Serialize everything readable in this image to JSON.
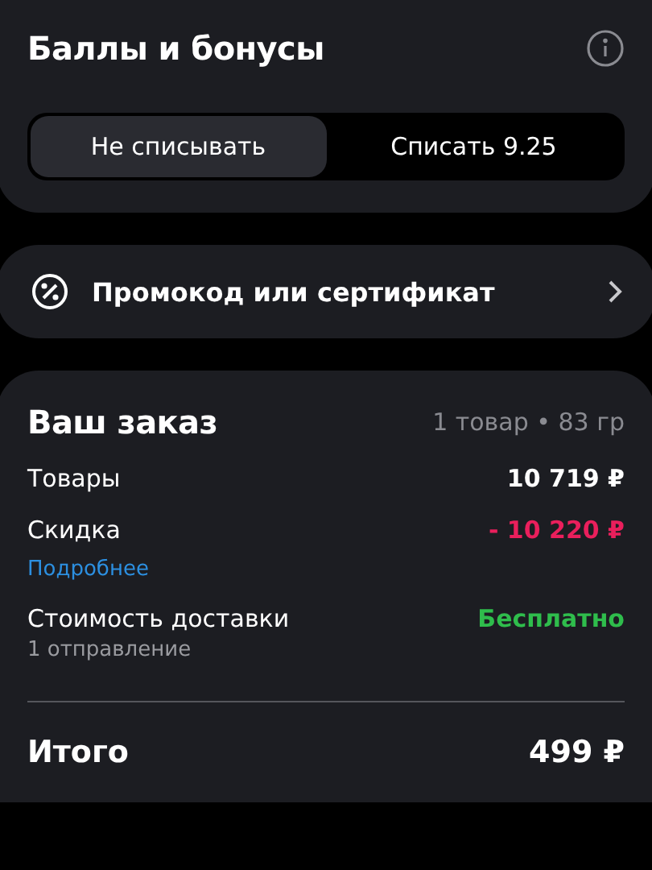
{
  "bonuses": {
    "title": "Баллы и бонусы",
    "options": [
      {
        "label": "Не списывать",
        "selected": true
      },
      {
        "label": "Списать 9.25",
        "selected": false
      }
    ]
  },
  "promo": {
    "label": "Промокод или сертификат"
  },
  "order": {
    "title": "Ваш заказ",
    "summary": "1 товар • 83 гр",
    "rows": [
      {
        "label": "Товары",
        "value": "10 719 ₽",
        "kind": "plain"
      },
      {
        "label": "Скидка",
        "value": "- 10 220 ₽",
        "kind": "discount",
        "link": "Подробнее"
      },
      {
        "label": "Стоимость доставки",
        "value": "Бесплатно",
        "kind": "free",
        "note": "1 отправление"
      }
    ],
    "total": {
      "label": "Итого",
      "value": "499 ₽"
    }
  }
}
